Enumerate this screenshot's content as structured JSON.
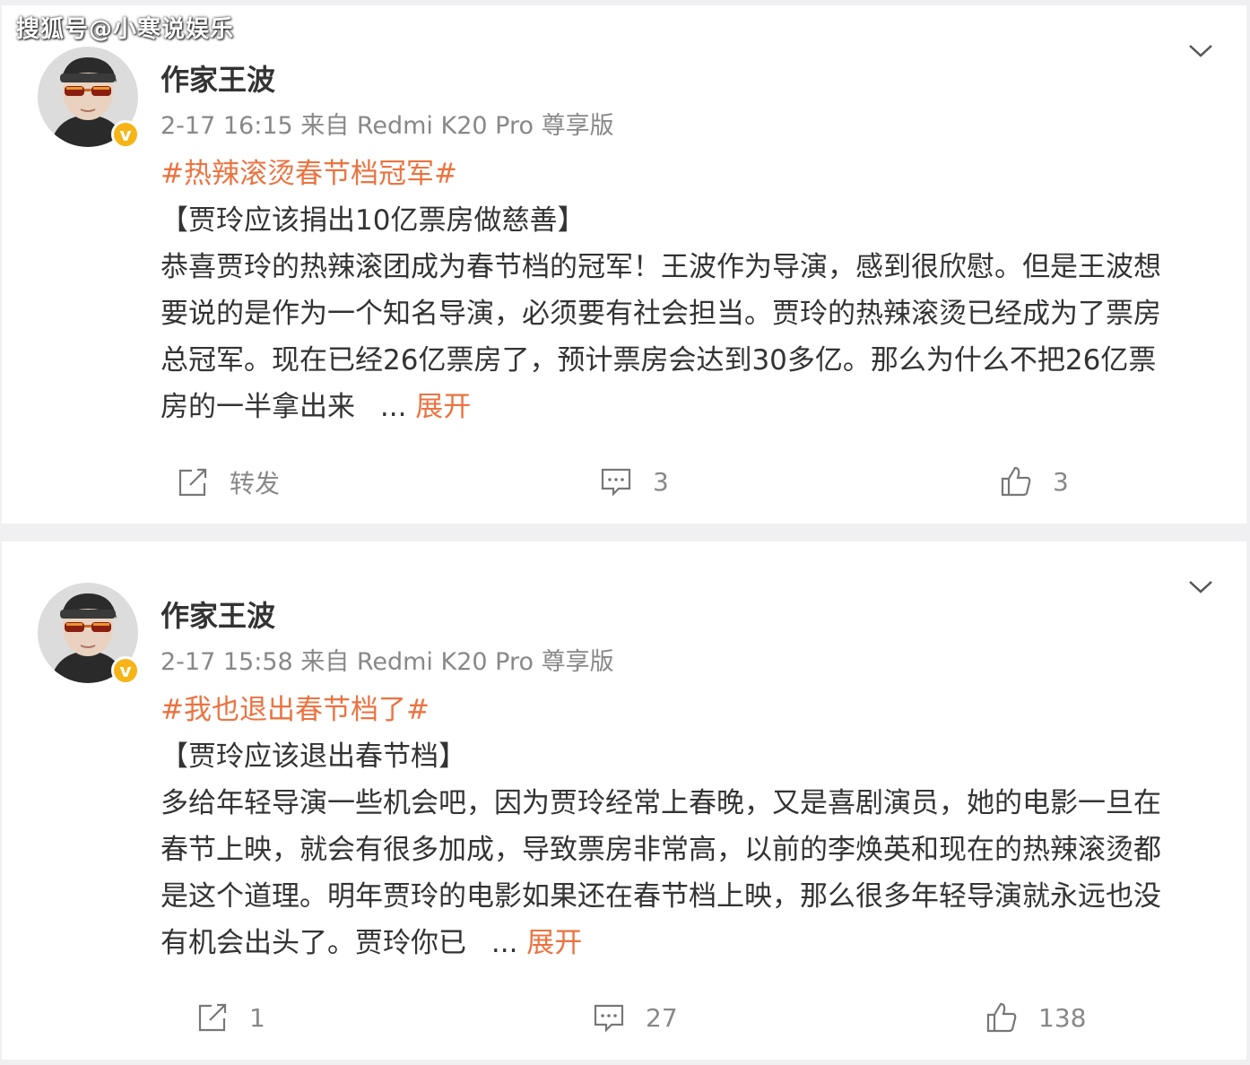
{
  "watermark": "搜狐号@小寒说娱乐",
  "posts": [
    {
      "author": "作家王波",
      "meta": "2-17 16:15 来自 Redmi K20 Pro 尊享版",
      "hashtag": "#热辣滚烫春节档冠军#",
      "headline": "【贾玲应该捐出10亿票房做慈善】",
      "lines": [
        "恭喜贾玲的热辣滚团成为春节档的冠军！王波作为导演，感到很欣慰。但是王波想",
        "要说的是作为一个知名导演，必须要有社会担当。贾玲的热辣滚烫已经成为了票房",
        "总冠军。现在已经26亿票房了，预计票房会达到30多亿。那么为什么不把26亿票"
      ],
      "last_line": "房的一半拿出来",
      "ellipsis": "...",
      "expand": "展开",
      "repost_label": "转发",
      "comment_count": "3",
      "like_count": "3"
    },
    {
      "author": "作家王波",
      "meta": "2-17 15:58 来自 Redmi K20 Pro 尊享版",
      "hashtag": "#我也退出春节档了#",
      "headline": "【贾玲应该退出春节档】",
      "lines": [
        "多给年轻导演一些机会吧，因为贾玲经常上春晚，又是喜剧演员，她的电影一旦在",
        "春节上映，就会有很多加成，导致票房非常高，以前的李焕英和现在的热辣滚烫都",
        "是这个道理。明年贾玲的电影如果还在春节档上映，那么很多年轻导演就永远也没"
      ],
      "last_line": "有机会出头了。贾玲你已",
      "ellipsis": "...",
      "expand": "展开",
      "repost_label": "1",
      "comment_count": "27",
      "like_count": "138"
    }
  ],
  "icons": {
    "chevron": "chevron-down-icon",
    "repost": "repost-icon",
    "comment": "comment-icon",
    "like": "like-icon",
    "verified": "verified-icon"
  },
  "colors": {
    "accent": "#eb7340",
    "verified": "#f6b417",
    "meta_gray": "#888888"
  }
}
